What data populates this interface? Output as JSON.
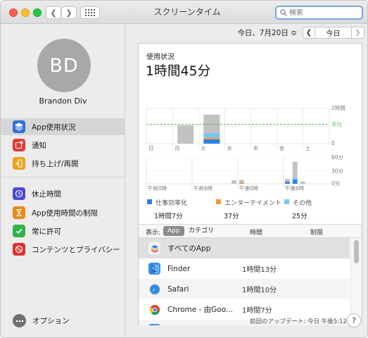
{
  "window": {
    "title": "スクリーンタイム"
  },
  "search": {
    "placeholder": "検索"
  },
  "user": {
    "initials": "BD",
    "name": "Brandon Div"
  },
  "sidebar": {
    "items": [
      {
        "label": "App使用状況",
        "icon": "layers-icon",
        "color": "#2f6fd8"
      },
      {
        "label": "通知",
        "icon": "notification-icon",
        "color": "#e23b33"
      },
      {
        "label": "持ち上げ/再開",
        "icon": "pickup-icon",
        "color": "#e6a21a"
      },
      {
        "label": "休止時間",
        "icon": "downtime-icon",
        "color": "#4a4bd1"
      },
      {
        "label": "App使用時間の制限",
        "icon": "hourglass-icon",
        "color": "#e68a1a"
      },
      {
        "label": "常に許可",
        "icon": "checkmark-icon",
        "color": "#34b24a"
      },
      {
        "label": "コンテンツとプライバシー",
        "icon": "no-entry-icon",
        "color": "#e0302c"
      }
    ],
    "options_label": "オプション"
  },
  "date": {
    "label": "今日、7月20日 ≎",
    "today_button": "今日"
  },
  "usage": {
    "label": "使用状況",
    "total": "1時間45分"
  },
  "chart_data": [
    {
      "type": "bar",
      "title": "",
      "categories": [
        "日",
        "月",
        "火",
        "水",
        "木",
        "金",
        "土"
      ],
      "series": [
        {
          "name": "仕事効率化",
          "values": [
            0,
            0,
            0.25,
            0,
            0,
            0,
            0
          ]
        },
        {
          "name": "エンターテイメント",
          "values": [
            0,
            0,
            0.1,
            0,
            0,
            0,
            0
          ]
        },
        {
          "name": "その他",
          "values": [
            0,
            0,
            0.25,
            0,
            0,
            0,
            0
          ]
        },
        {
          "name": "",
          "values": [
            0,
            1.05,
            1.05,
            0,
            0,
            0,
            0
          ]
        }
      ],
      "y_ticks": [
        "2時間",
        "1時間",
        "0"
      ],
      "average_label": "平均",
      "average_value": 1.1,
      "ylim": [
        0,
        2
      ],
      "colors": {
        "work": "#2f7fe8",
        "entertainment": "#f29a38",
        "other": "#73c9f0",
        "past": "#c2c2c2",
        "average": "#4cc45a"
      }
    },
    {
      "type": "bar",
      "title": "",
      "x_ticks": [
        "午前0時",
        "午前6時",
        "午後0時",
        "午後6時"
      ],
      "y_ticks": [
        "60分",
        "30分",
        "0分"
      ],
      "ylim": [
        0,
        60
      ],
      "hours": [
        0,
        1,
        2,
        3,
        4,
        5,
        6,
        7,
        8,
        9,
        10,
        11,
        12,
        13,
        14,
        15,
        16,
        17,
        18,
        19,
        20,
        21,
        22,
        23
      ],
      "series": [
        {
          "name": "仕事効率化",
          "values": [
            0,
            0,
            0,
            0,
            0,
            0,
            0,
            0,
            0,
            0,
            0,
            0,
            0,
            0,
            0,
            0,
            0,
            0,
            5,
            10,
            0,
            0,
            0,
            0
          ]
        },
        {
          "name": "エンターテイメント",
          "values": [
            0,
            0,
            0,
            0,
            0,
            0,
            0,
            0,
            0,
            0,
            0,
            0,
            3,
            0,
            0,
            0,
            0,
            0,
            0,
            0,
            0,
            0,
            0,
            0
          ]
        },
        {
          "name": "その他",
          "values": [
            0,
            0,
            0,
            0,
            0,
            0,
            0,
            0,
            0,
            0,
            0,
            0,
            0,
            0,
            0,
            0,
            0,
            0,
            0,
            3,
            0,
            0,
            0,
            0
          ]
        },
        {
          "name": "",
          "values": [
            0,
            0,
            0,
            0,
            0,
            0,
            0,
            0,
            0,
            0,
            0,
            8,
            6,
            0,
            0,
            0,
            0,
            0,
            6,
            38,
            5,
            0,
            0,
            0
          ]
        }
      ]
    }
  ],
  "legend": [
    {
      "name": "仕事効率化",
      "time": "1時間7分",
      "color": "#2f7fe8"
    },
    {
      "name": "エンターテイメント",
      "time": "37分",
      "color": "#f29a38"
    },
    {
      "name": "その他",
      "time": "25分",
      "color": "#73c9f0"
    }
  ],
  "table": {
    "display_label": "表示:",
    "segment_app": "App",
    "segment_category": "カテゴリ",
    "col_time": "時間",
    "col_limit": "制限",
    "rows": [
      {
        "name": "すべてのApp",
        "time": "",
        "icon": "layers-icon"
      },
      {
        "name": "Finder",
        "time": "1時間13分",
        "icon": "finder-icon"
      },
      {
        "name": "Safari",
        "time": "1時間10分",
        "icon": "safari-icon"
      },
      {
        "name": "Chrome - 由Goo...",
        "time": "1時間7分",
        "icon": "chrome-icon"
      }
    ]
  },
  "footer": {
    "last_update": "前回のアップデート: 今日 午後5:12",
    "help": "?"
  }
}
